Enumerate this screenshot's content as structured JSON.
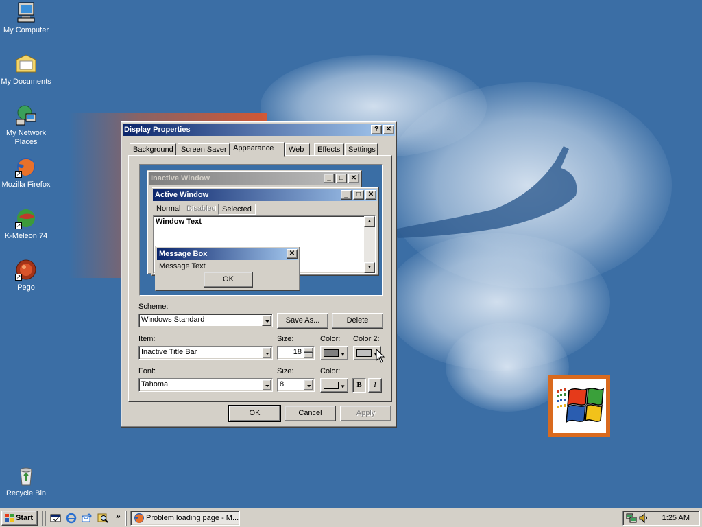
{
  "desktop": {
    "icons": [
      {
        "label": "My Computer"
      },
      {
        "label": "My Documents"
      },
      {
        "label": "My Network Places"
      },
      {
        "label": "Mozilla Firefox"
      },
      {
        "label": "K-Meleon 74"
      },
      {
        "label": "Pego"
      },
      {
        "label": "Recycle Bin"
      }
    ]
  },
  "dialog": {
    "title": "Display Properties",
    "help_glyph": "?",
    "close_glyph": "✕",
    "tabs": [
      "Background",
      "Screen Saver",
      "Appearance",
      "Web",
      "Effects",
      "Settings"
    ],
    "active_tab": "Appearance",
    "preview": {
      "inactive_title": "Inactive Window",
      "active_title": "Active Window",
      "menu_items": [
        "Normal",
        "Disabled",
        "Selected"
      ],
      "window_text": "Window Text",
      "msgbox_title": "Message Box",
      "msgbox_text": "Message Text",
      "msgbox_ok": "OK"
    },
    "scheme_label": "Scheme:",
    "scheme_value": "Windows Standard",
    "save_as": "Save As...",
    "delete": "Delete",
    "item_label": "Item:",
    "item_value": "Inactive Title Bar",
    "size_label": "Size:",
    "item_size": "18",
    "color_label": "Color:",
    "color2_label": "Color 2:",
    "font_label": "Font:",
    "font_value": "Tahoma",
    "font_size_label": "Size:",
    "font_size": "8",
    "font_color_label": "Color:",
    "bold": "B",
    "italic": "I",
    "ok": "OK",
    "cancel": "Cancel",
    "apply": "Apply"
  },
  "taskbar": {
    "start_label": "Start",
    "chevron": "»",
    "task_label": "Problem loading page - M...",
    "clock": "1:25 AM"
  },
  "colors": {
    "desktop": "#3b6ea5",
    "active_title_start": "#0a246a",
    "active_title_end": "#a6caf0",
    "inactive_title": "#808080",
    "face": "#d4d0c8"
  }
}
